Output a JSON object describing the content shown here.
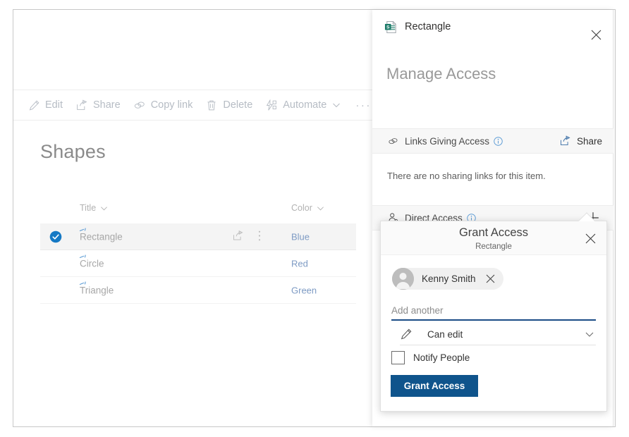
{
  "list_view": {
    "command_bar": {
      "items": [
        {
          "label": "Edit",
          "icon": "pencil-icon",
          "has_chevron": false
        },
        {
          "label": "Share",
          "icon": "share-icon",
          "has_chevron": false
        },
        {
          "label": "Copy link",
          "icon": "link-icon",
          "has_chevron": false
        },
        {
          "label": "Delete",
          "icon": "trash-icon",
          "has_chevron": false
        },
        {
          "label": "Automate",
          "icon": "automate-icon",
          "has_chevron": true
        }
      ],
      "overflow_label": "···"
    },
    "title": "Shapes",
    "columns": [
      {
        "label": "Title"
      },
      {
        "label": "Color"
      }
    ],
    "rows": [
      {
        "title": "Rectangle",
        "color": "Blue",
        "selected": true
      },
      {
        "title": "Circle",
        "color": "Red",
        "selected": false
      },
      {
        "title": "Triangle",
        "color": "Green",
        "selected": false
      }
    ]
  },
  "panel": {
    "header_title": "Rectangle",
    "header_icon": "sharepoint-list-item-icon",
    "close_icon": "close-icon",
    "heading": "Manage Access",
    "links_section": {
      "label": "Links Giving Access",
      "icon": "link-icon",
      "info_icon": "info-icon",
      "action_label": "Share",
      "action_icon": "share-icon",
      "empty_text": "There are no sharing links for this item."
    },
    "direct_section": {
      "label": "Direct Access",
      "icon": "person-icon",
      "info_icon": "info-icon",
      "add_icon": "plus-icon"
    }
  },
  "grant_access": {
    "title": "Grant Access",
    "subtitle": "Rectangle",
    "close_icon": "close-icon",
    "person": {
      "name": "Kenny Smith",
      "avatar_icon": "person-avatar-icon",
      "remove_icon": "close-icon"
    },
    "add_another_placeholder": "Add another",
    "add_another_value": "",
    "permission": {
      "label": "Can edit",
      "icon": "pencil-icon",
      "chevron_icon": "chevron-down-icon"
    },
    "notify": {
      "label": "Notify People",
      "checked": false
    },
    "submit_label": "Grant Access",
    "accent_color": "#0f548c"
  }
}
